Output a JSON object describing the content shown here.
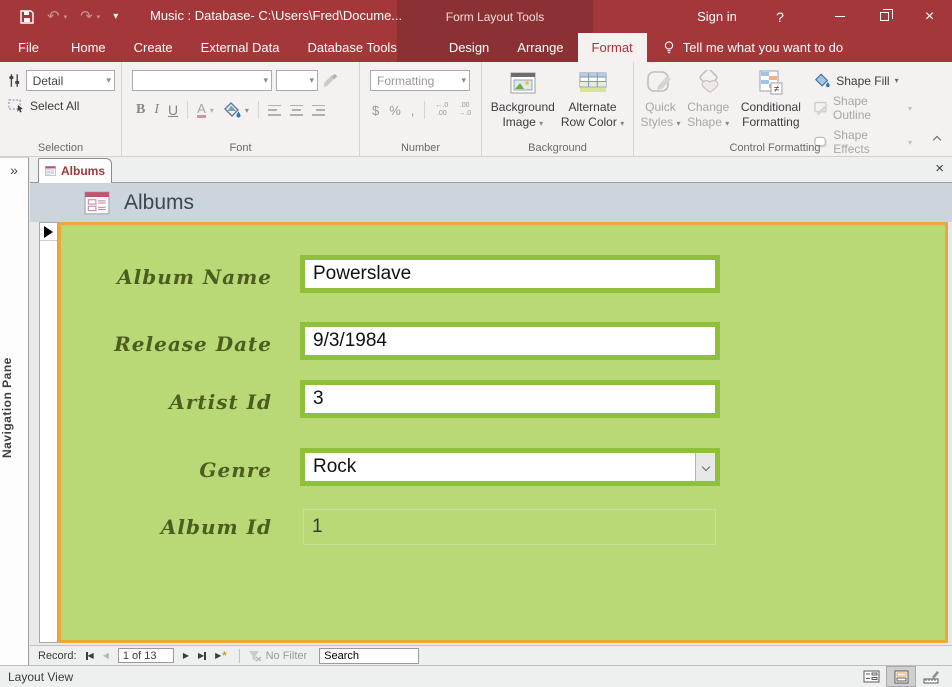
{
  "colors": {
    "red": "#a4373a",
    "red-dark": "#8b3134",
    "ribbon-bg": "#f5f1f1",
    "form-green": "#b9d876",
    "box-green": "#8fc03c",
    "orange": "#eda83c",
    "label-green": "#4b5e1f",
    "header-bg": "#ccd5db",
    "header-text": "#3a4750",
    "tab-red": "#9e3a38"
  },
  "icons": {
    "undo": "↶",
    "redo": "↷",
    "dropdown": "▾",
    "qat_dropdown": "▾",
    "close": "×",
    "help": "?",
    "nav_expand": "»",
    "tri_left": "◀",
    "tri_right": "▶",
    "new_star": "*"
  },
  "titlebar": {
    "title": "Music : Database- C:\\Users\\Fred\\Docume...",
    "contextual_label": "Form Layout Tools",
    "sign_in": "Sign in"
  },
  "menu": {
    "tabs": [
      "File",
      "Home",
      "Create",
      "External Data",
      "Database Tools"
    ],
    "contextual_tabs": [
      "Design",
      "Arrange"
    ],
    "active_tab": "Format",
    "tell_me": "Tell me what you want to do"
  },
  "ribbon": {
    "selection": {
      "combo_value": "Detail",
      "select_all": "Select All",
      "group": "Selection"
    },
    "font": {
      "group": "Font",
      "bold": "B",
      "italic": "I",
      "underline": "U",
      "font_color": "A"
    },
    "number": {
      "combo_value": "Formatting",
      "group": "Number",
      "currency": "$",
      "percent": "%",
      "comma": ",",
      "dec1": [
        "←.0",
        ".00"
      ],
      "dec2": [
        ".00",
        "→.0"
      ]
    },
    "background": {
      "group": "Background",
      "image_l1": "Background",
      "image_l2": "Image",
      "altrow_l1": "Alternate",
      "altrow_l2": "Row Color"
    },
    "control": {
      "group": "Control Formatting",
      "quick_l1": "Quick",
      "quick_l2": "Styles",
      "change_l1": "Change",
      "change_l2": "Shape",
      "cond_l1": "Conditional",
      "cond_l2": "Formatting",
      "fill": "Shape Fill",
      "outline": "Shape Outline",
      "effects": "Shape Effects"
    }
  },
  "document": {
    "tab_label": "Albums",
    "header_title": "Albums"
  },
  "form": {
    "fields": [
      {
        "label": "Album Name",
        "value": "Powerslave",
        "type": "text"
      },
      {
        "label": "Release Date",
        "value": "9/3/1984",
        "type": "text"
      },
      {
        "label": "Artist Id",
        "value": "3",
        "type": "text"
      },
      {
        "label": "Genre",
        "value": "Rock",
        "type": "combo"
      },
      {
        "label": "Album Id",
        "value": "1",
        "type": "readonly"
      }
    ]
  },
  "record_nav": {
    "label": "Record:",
    "position": "1 of 13",
    "no_filter": "No Filter",
    "search_value": "Search"
  },
  "status": {
    "view_label": "Layout View"
  },
  "nav_pane": {
    "label": "Navigation Pane"
  }
}
